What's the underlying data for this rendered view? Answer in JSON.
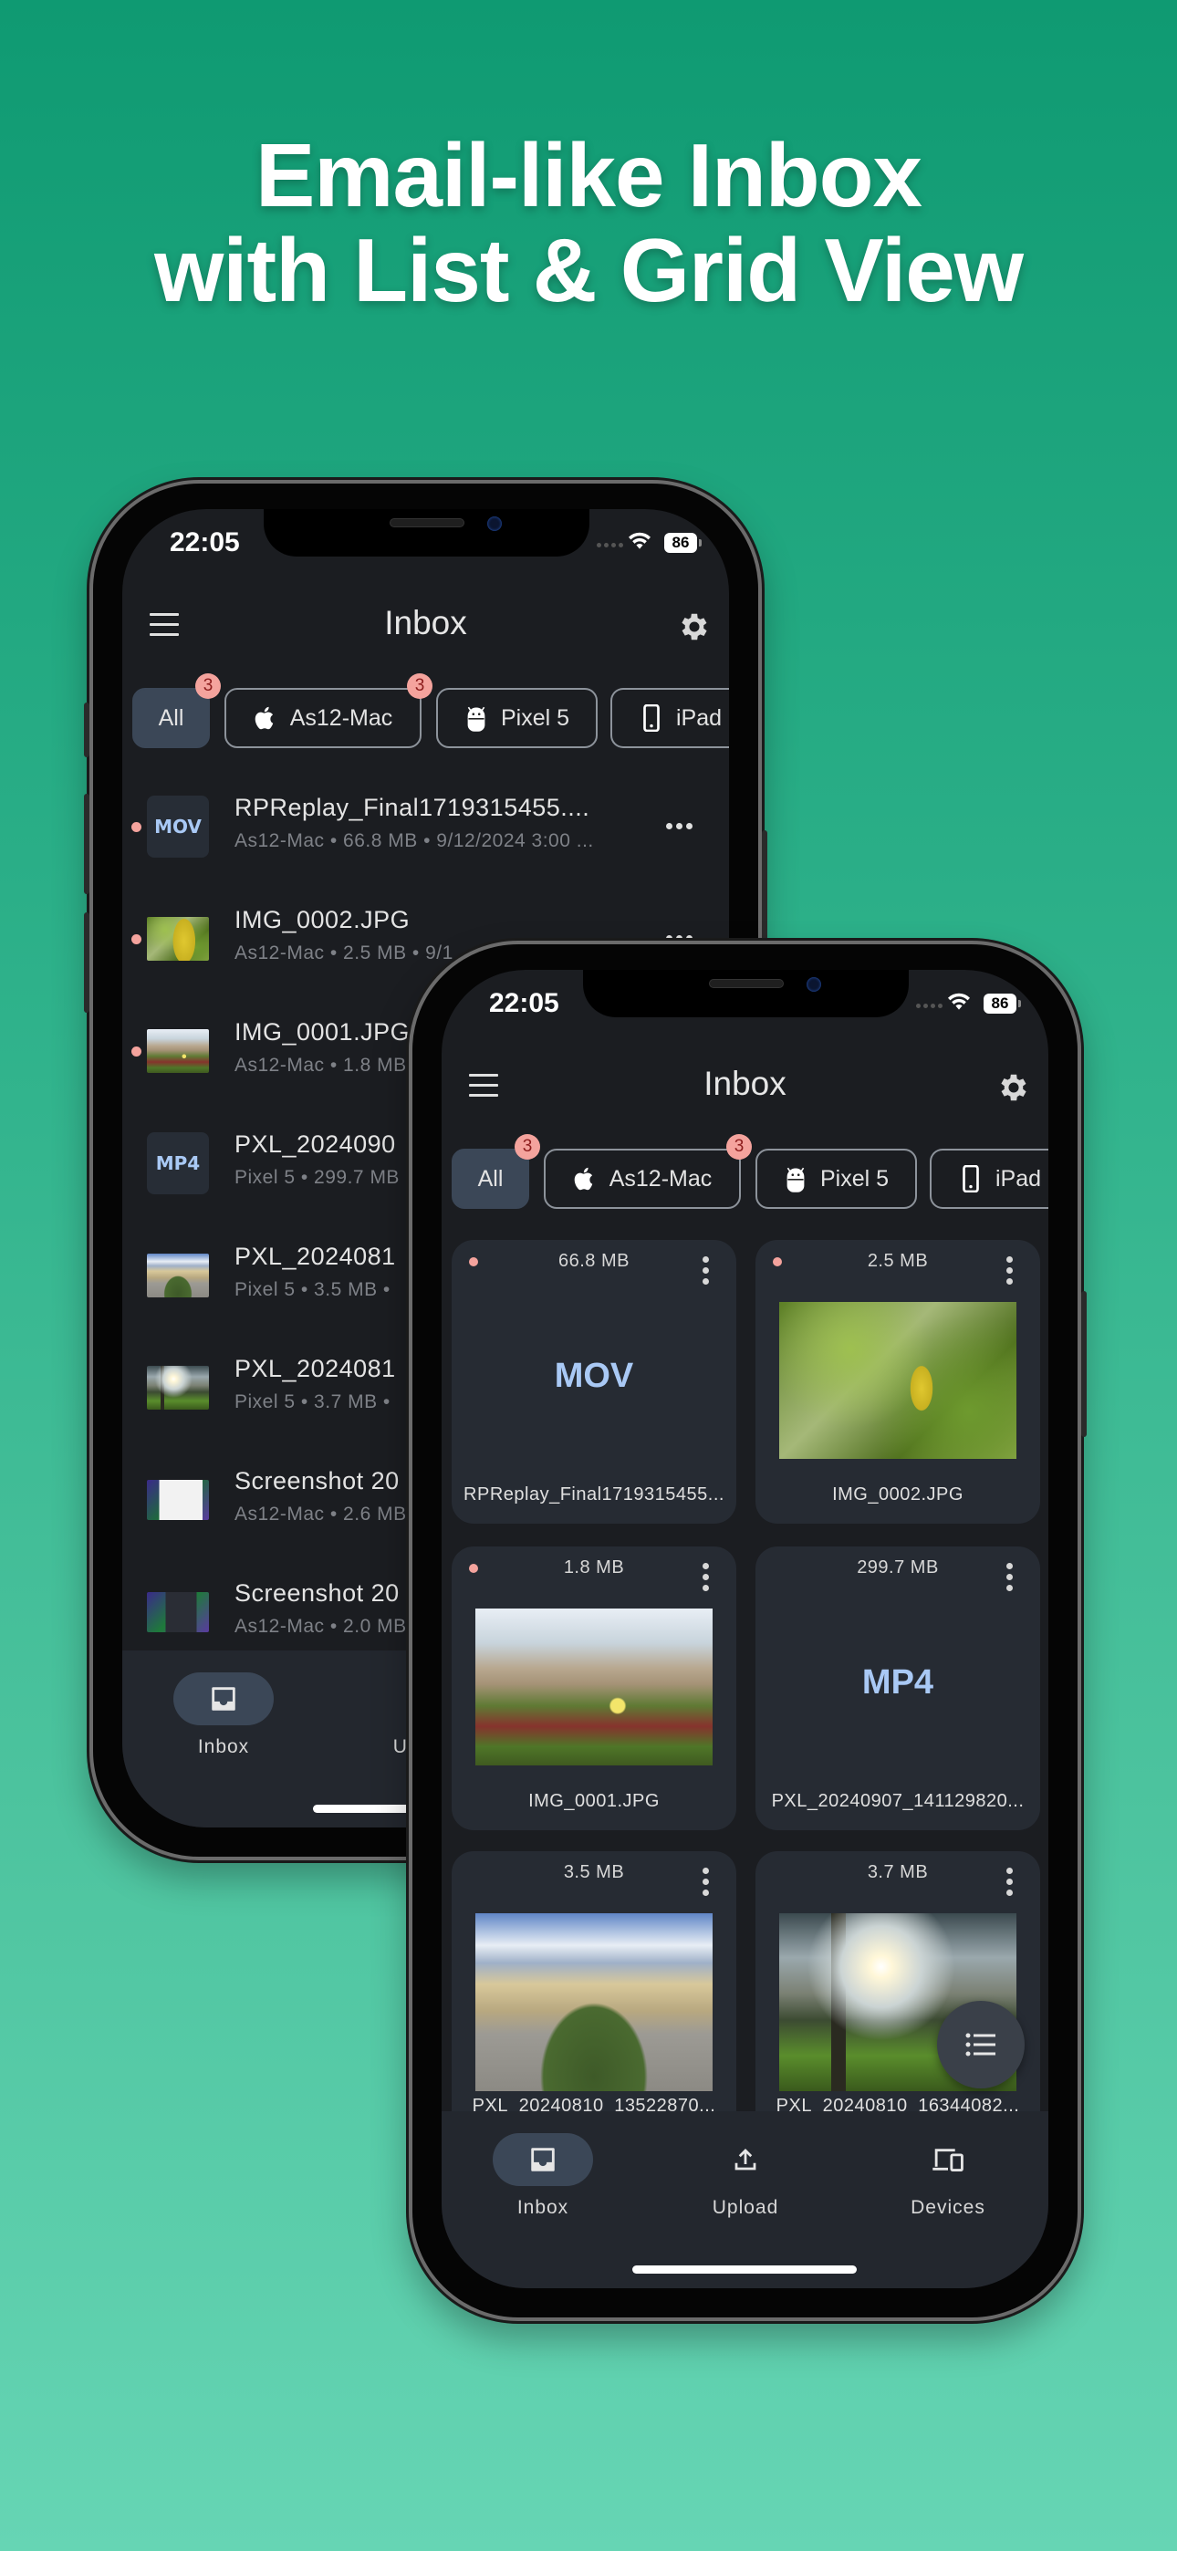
{
  "headline": {
    "line1": "Email-like Inbox",
    "line2": "with List & Grid View"
  },
  "colors": {
    "background_top": "#0f9a72",
    "background_bottom": "#66d5b4",
    "screen_bg": "#1b1d21",
    "card_bg": "#262b33",
    "selected": "#3b4757",
    "badge": "#f4a39d",
    "type_label": "#a9c9f5"
  },
  "status": {
    "time": "22:05",
    "battery": "86",
    "icons": [
      "cellular-icon",
      "wifi-icon",
      "battery-icon"
    ]
  },
  "appbar": {
    "title": "Inbox",
    "menu_icon": "hamburger-menu-icon",
    "settings_icon": "gear-icon"
  },
  "filters": [
    {
      "label": "All",
      "badge": "3",
      "selected": true
    },
    {
      "label": "As12-Mac",
      "icon": "apple-icon",
      "badge": "3"
    },
    {
      "label": "Pixel 5",
      "icon": "android-icon"
    },
    {
      "label": "iPad",
      "icon": "phone-icon"
    }
  ],
  "list_view": {
    "items": [
      {
        "title": "RPReplay_Final1719315455....",
        "subtitle": "As12-Mac • 66.8 MB • 9/12/2024 3:00 ...",
        "thumb": "MOV",
        "unread": true
      },
      {
        "title": "IMG_0002.JPG",
        "subtitle": "As12-Mac • 2.5 MB • 9/1",
        "unread": true
      },
      {
        "title": "IMG_0001.JPG",
        "subtitle": "As12-Mac • 1.8 MB",
        "unread": true
      },
      {
        "title": "PXL_2024090",
        "subtitle": "Pixel 5 • 299.7 MB",
        "thumb": "MP4"
      },
      {
        "title": "PXL_2024081",
        "subtitle": "Pixel 5 • 3.5 MB •"
      },
      {
        "title": "PXL_2024081",
        "subtitle": "Pixel 5 • 3.7 MB •"
      },
      {
        "title": "Screenshot 20",
        "subtitle": "As12-Mac • 2.6 MB"
      },
      {
        "title": "Screenshot 20",
        "subtitle": "As12-Mac • 2.0 MB"
      }
    ]
  },
  "grid_view": {
    "items": [
      {
        "size": "66.8 MB",
        "name": "RPReplay_Final1719315455...",
        "type": "MOV",
        "unread": true
      },
      {
        "size": "2.5 MB",
        "name": "IMG_0002.JPG",
        "unread": true
      },
      {
        "size": "1.8 MB",
        "name": "IMG_0001.JPG",
        "unread": true
      },
      {
        "size": "299.7 MB",
        "name": "PXL_20240907_141129820...",
        "type": "MP4"
      },
      {
        "size": "3.5 MB",
        "name": "PXL_20240810_13522870..."
      },
      {
        "size": "3.7 MB",
        "name": "PXL_20240810_16344082..."
      }
    ],
    "fab_icon": "list-view-icon"
  },
  "nav": [
    {
      "label": "Inbox",
      "icon": "inbox-icon",
      "selected": true
    },
    {
      "label": "Upload",
      "icon": "upload-icon"
    },
    {
      "label": "Devices",
      "icon": "devices-icon"
    }
  ]
}
